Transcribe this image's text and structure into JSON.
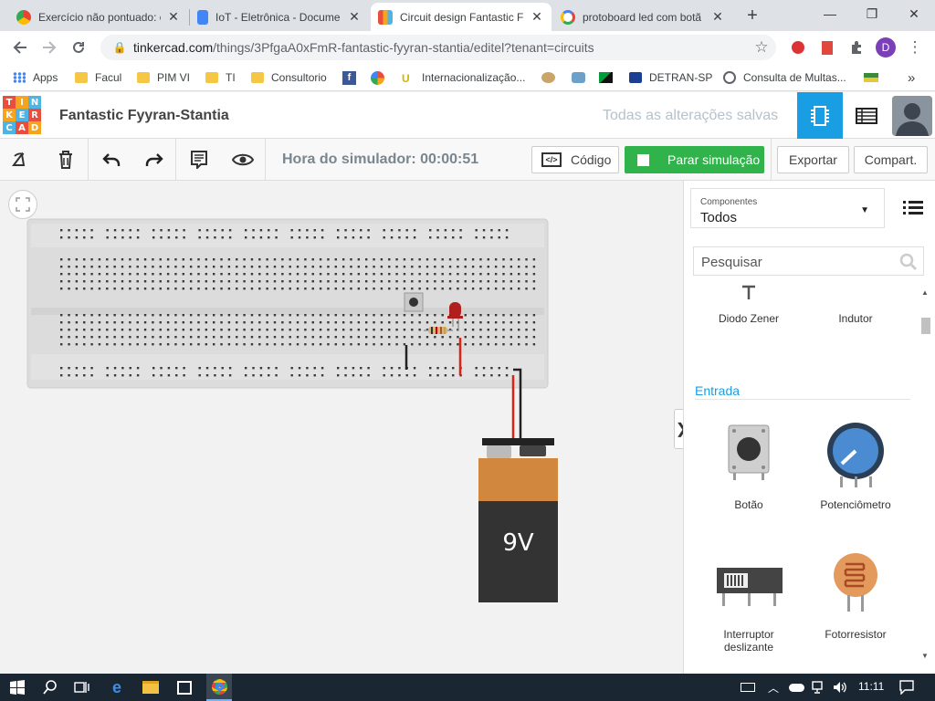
{
  "browser": {
    "tabs": [
      {
        "title": "Exercício não pontuado: c",
        "favicon_color": "#4285f4",
        "active": false
      },
      {
        "title": "IoT - Eletrônica - Docume",
        "favicon_color": "#4285f4",
        "active": false
      },
      {
        "title": "Circuit design Fantastic F",
        "favicon_color": "#f0a030",
        "active": true
      },
      {
        "title": "protoboard led com botã",
        "favicon_color": "#ea4335",
        "active": false
      }
    ],
    "new_tab": "+",
    "window_controls": {
      "minimize": "—",
      "restore": "❐",
      "close": "✕"
    },
    "url_host": "tinkercad.com",
    "url_path": "/things/3PfgaA0xFmR-fantastic-fyyran-stantia/editel?tenant=circuits",
    "profile_initial": "D",
    "bookmarks": [
      {
        "label": "Apps",
        "icon": "apps-grid-icon"
      },
      {
        "label": "Facul",
        "icon": "folder-icon"
      },
      {
        "label": "PIM VI",
        "icon": "folder-icon"
      },
      {
        "label": "TI",
        "icon": "folder-icon"
      },
      {
        "label": "Consultorio",
        "icon": "folder-icon"
      },
      {
        "label": "",
        "icon": "facebook-icon"
      },
      {
        "label": "",
        "icon": "colorful-ball-icon"
      },
      {
        "label": "Internacionalização...",
        "icon": "internacionalizacao-icon"
      },
      {
        "label": "",
        "icon": "site-icon"
      },
      {
        "label": "",
        "icon": "site-icon"
      },
      {
        "label": "",
        "icon": "flag-icon"
      },
      {
        "label": "DETRAN-SP",
        "icon": "detran-icon"
      },
      {
        "label": "Consulta de Multas...",
        "icon": "globe-icon"
      },
      {
        "label": "",
        "icon": "flag-icon"
      }
    ],
    "more_bookmarks": "»"
  },
  "app": {
    "logo_letters": [
      "T",
      "I",
      "N",
      "K",
      "E",
      "R",
      "C",
      "A",
      "D"
    ],
    "logo_colors": [
      "#e94e3c",
      "#f7a41d",
      "#4db4e6",
      "#e94e3c",
      "#f7a41d",
      "#4db4e6",
      "#e94e3c",
      "#f7a41d",
      "#4db4e6"
    ],
    "design_title": "Fantastic Fyyran-Stantia",
    "saved_status": "Todas as alterações salvas",
    "accent_color": "#1a9ee3"
  },
  "toolbar": {
    "sim_time": "Hora do simulador: 00:00:51",
    "code_label": "Código",
    "stop_sim_label": "Parar simulação",
    "export_label": "Exportar",
    "share_label": "Compart."
  },
  "circuit": {
    "battery_label": "9V"
  },
  "panel": {
    "category_caption": "Componentes",
    "category_value": "Todos",
    "search_placeholder": "Pesquisar",
    "section_title": "Entrada",
    "components_top": [
      {
        "name": "Diodo Zener"
      },
      {
        "name": "Indutor"
      }
    ],
    "components": [
      {
        "name": "Botão"
      },
      {
        "name": "Potenciômetro"
      },
      {
        "name": "Interruptor deslizante"
      },
      {
        "name": "Fotorresistor"
      }
    ]
  },
  "taskbar": {
    "time": "11:11"
  }
}
